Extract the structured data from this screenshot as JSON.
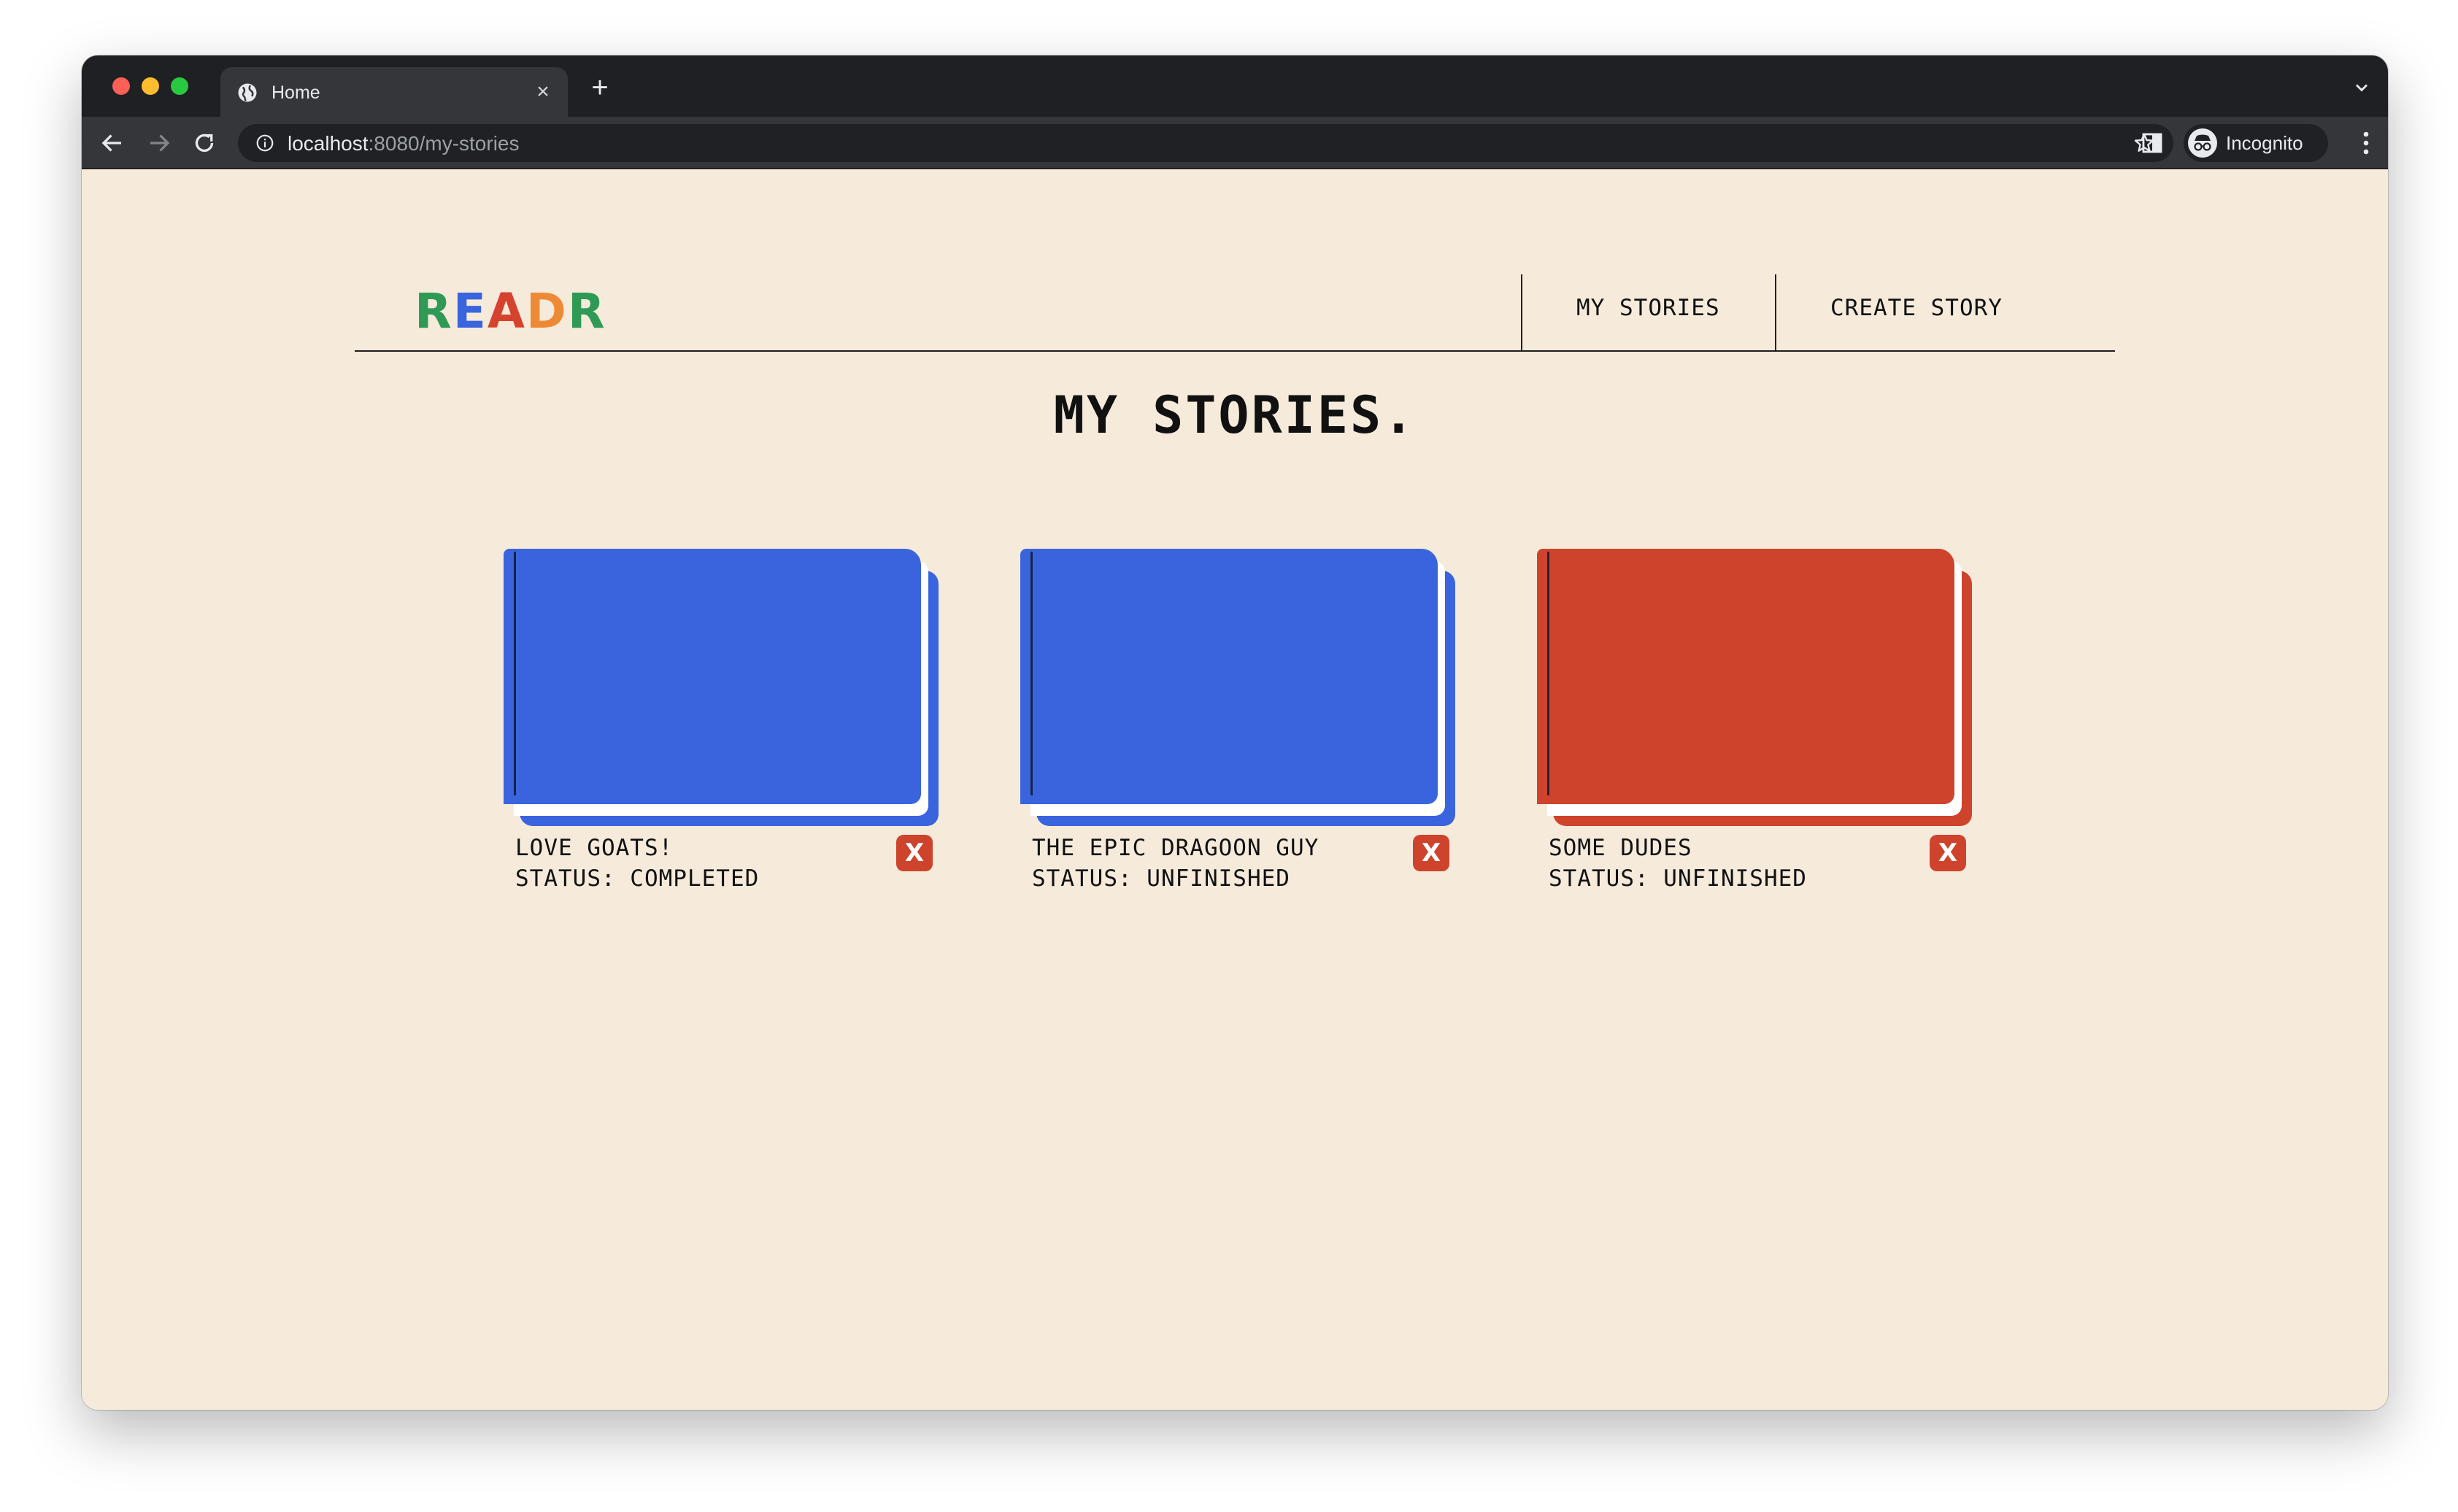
{
  "browser": {
    "tab_title": "Home",
    "url_host": "localhost",
    "url_path": ":8080/my-stories",
    "profile_label": "Incognito"
  },
  "header": {
    "logo_letters": [
      {
        "char": "R",
        "color": "#2f9a55"
      },
      {
        "char": "E",
        "color": "#3a64dd"
      },
      {
        "char": "A",
        "color": "#d5432e"
      },
      {
        "char": "D",
        "color": "#ee8a35"
      },
      {
        "char": "R",
        "color": "#2f9a55"
      }
    ],
    "nav": [
      {
        "label": "MY STORIES"
      },
      {
        "label": "CREATE STORY"
      }
    ]
  },
  "main": {
    "title": "MY STORIES.",
    "stories": [
      {
        "title": "LOVE GOATS!",
        "status": "STATUS: COMPLETED",
        "cover_color": "#3a64dd",
        "delete_label": "X"
      },
      {
        "title": "THE EPIC DRAGOON GUY",
        "status": "STATUS: UNFINISHED",
        "cover_color": "#3a64dd",
        "delete_label": "X"
      },
      {
        "title": "SOME DUDES",
        "status": "STATUS: UNFINISHED",
        "cover_color": "#ce432c",
        "delete_label": "X"
      }
    ]
  },
  "colors": {
    "page_background": "#f6ebdb",
    "delete_button": "#ce432c"
  }
}
